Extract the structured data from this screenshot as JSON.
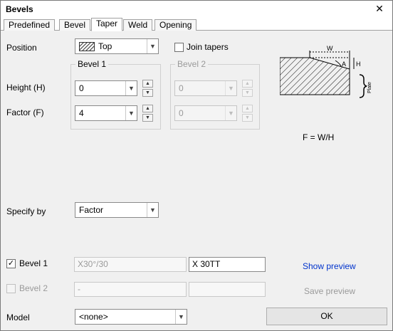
{
  "window": {
    "title": "Bevels",
    "close_glyph": "✕"
  },
  "tabs": [
    {
      "label": "Predefined"
    },
    {
      "label": "Bevel"
    },
    {
      "label": "Taper"
    },
    {
      "label": "Weld"
    },
    {
      "label": "Opening"
    }
  ],
  "position": {
    "label": "Position",
    "value": "Top"
  },
  "join_tapers": {
    "label": "Join tapers",
    "checked": false
  },
  "bevel1_group": {
    "title": "Bevel 1",
    "height_value": "0",
    "factor_value": "4"
  },
  "bevel2_group": {
    "title": "Bevel 2",
    "height_value": "0",
    "factor_value": "0"
  },
  "height_label": "Height (H)",
  "factor_label": "Factor (F)",
  "diagram": {
    "w_label": "W",
    "h_label": "H",
    "a_label": "A",
    "side_label": "Plate",
    "formula": "F = W/H"
  },
  "specify_by": {
    "label": "Specify by",
    "value": "Factor"
  },
  "bevel1_row": {
    "label": "Bevel 1",
    "checked": true,
    "field1": "X30°/30",
    "field2": "X 30TT"
  },
  "bevel2_row": {
    "label": "Bevel 2",
    "checked": false,
    "field1": "-",
    "field2": ""
  },
  "show_preview": "Show preview",
  "save_preview": "Save preview",
  "model": {
    "label": "Model",
    "value": "<none>"
  },
  "ok_button": "OK"
}
